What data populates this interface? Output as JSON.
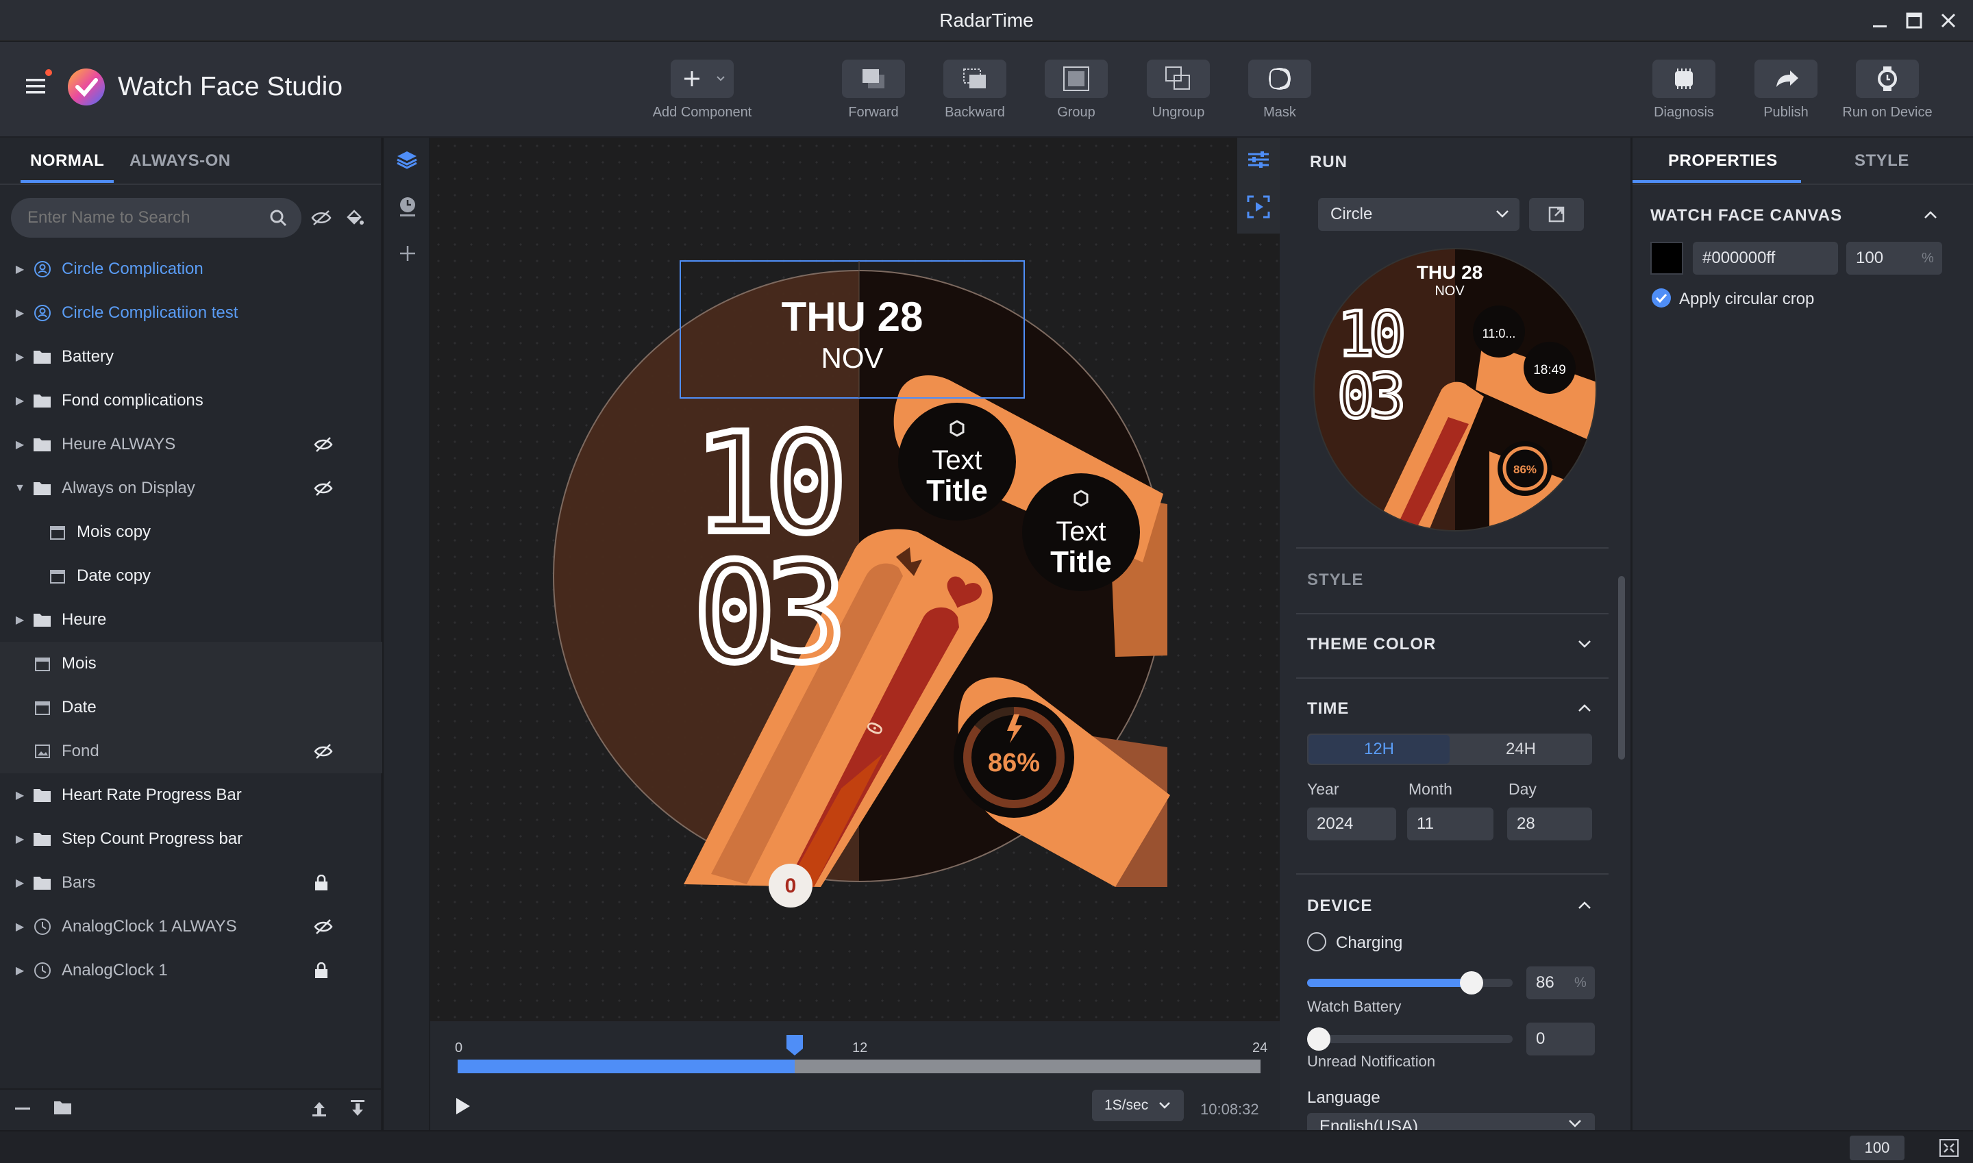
{
  "window": {
    "title": "RadarTime"
  },
  "app": {
    "name": "Watch Face Studio"
  },
  "toolbar": {
    "add_component": "Add Component",
    "forward": "Forward",
    "backward": "Backward",
    "group": "Group",
    "ungroup": "Ungroup",
    "mask": "Mask",
    "diagnosis": "Diagnosis",
    "publish": "Publish",
    "run_on_device": "Run on Device"
  },
  "layers": {
    "tabs": [
      "NORMAL",
      "ALWAYS-ON"
    ],
    "search_placeholder": "Enter Name to Search",
    "items": [
      {
        "label": "Circle Complication",
        "type": "complication",
        "expanded": false,
        "hidden": false,
        "locked": false
      },
      {
        "label": "Circle Complicatiion test",
        "type": "complication",
        "expanded": false,
        "hidden": false,
        "locked": false
      },
      {
        "label": "Battery",
        "type": "folder",
        "expanded": false,
        "hidden": false,
        "locked": false
      },
      {
        "label": "Fond complications",
        "type": "folder",
        "expanded": false,
        "hidden": false,
        "locked": false
      },
      {
        "label": "Heure ALWAYS",
        "type": "folder",
        "expanded": false,
        "hidden": true,
        "locked": false
      },
      {
        "label": "Always on Display",
        "type": "folder",
        "expanded": true,
        "hidden": true,
        "locked": false
      },
      {
        "label": "Mois copy",
        "type": "date",
        "expanded": false,
        "hidden": false,
        "locked": false
      },
      {
        "label": "Date copy",
        "type": "date",
        "expanded": false,
        "hidden": false,
        "locked": false
      },
      {
        "label": "Heure",
        "type": "folder",
        "expanded": false,
        "hidden": false,
        "locked": false
      },
      {
        "label": "Mois",
        "type": "date",
        "expanded": false,
        "hidden": false,
        "locked": false
      },
      {
        "label": "Date",
        "type": "date",
        "expanded": false,
        "hidden": false,
        "locked": false
      },
      {
        "label": "Fond",
        "type": "image",
        "expanded": false,
        "hidden": true,
        "locked": false
      },
      {
        "label": "Heart Rate Progress Bar",
        "type": "folder",
        "expanded": false,
        "hidden": false,
        "locked": false
      },
      {
        "label": "Step Count Progress bar",
        "type": "folder",
        "expanded": false,
        "hidden": false,
        "locked": false
      },
      {
        "label": "Bars",
        "type": "folder",
        "expanded": false,
        "hidden": false,
        "locked": true
      },
      {
        "label": "AnalogClock 1 ALWAYS",
        "type": "clock",
        "expanded": false,
        "hidden": true,
        "locked": false
      },
      {
        "label": "AnalogClock 1",
        "type": "clock",
        "expanded": false,
        "hidden": false,
        "locked": true
      }
    ]
  },
  "watchface": {
    "day": "THU 28",
    "month": "NOV",
    "hour": "10",
    "minute": "03",
    "comp1_line1": "Text",
    "comp1_line2": "Title",
    "comp2_line1": "Text",
    "comp2_line2": "Title",
    "battery": "86%",
    "bar_value": "0",
    "bar_bottom_value": "0"
  },
  "timeline": {
    "start": "0",
    "mid": "12",
    "end": "24",
    "position_fraction": 0.42,
    "speed": "1S/sec",
    "time": "10:08:32"
  },
  "run": {
    "title": "RUN",
    "shape": "Circle",
    "preview": {
      "day": "THU 28",
      "month": "NOV",
      "hour": "10",
      "minute": "03",
      "comp1": "11:0...",
      "comp2": "18:49",
      "battery": "86%"
    },
    "style_label": "STYLE",
    "theme_color": "THEME COLOR",
    "time_label": "TIME",
    "time_modes": [
      "12H",
      "24H"
    ],
    "year_label": "Year",
    "month_label": "Month",
    "day_label": "Day",
    "year": "2024",
    "month": "11",
    "day": "28",
    "device_label": "DEVICE",
    "charging": "Charging",
    "watch_battery_value": "86",
    "watch_battery_fraction": 0.86,
    "percent": "%",
    "watch_battery_label": "Watch Battery",
    "unread_value": "0",
    "unread_label": "Unread Notification",
    "language_label": "Language",
    "language": "English(USA)"
  },
  "properties": {
    "tabs": [
      "PROPERTIES",
      "STYLE"
    ],
    "section": "WATCH FACE CANVAS",
    "color_hex": "#000000ff",
    "opacity": "100",
    "percent": "%",
    "circular_crop": "Apply circular crop"
  },
  "status": {
    "zoom": "100"
  },
  "colors": {
    "accent": "#4f8ef7",
    "orange": "#f2914a",
    "dark_red": "#a3261f"
  }
}
